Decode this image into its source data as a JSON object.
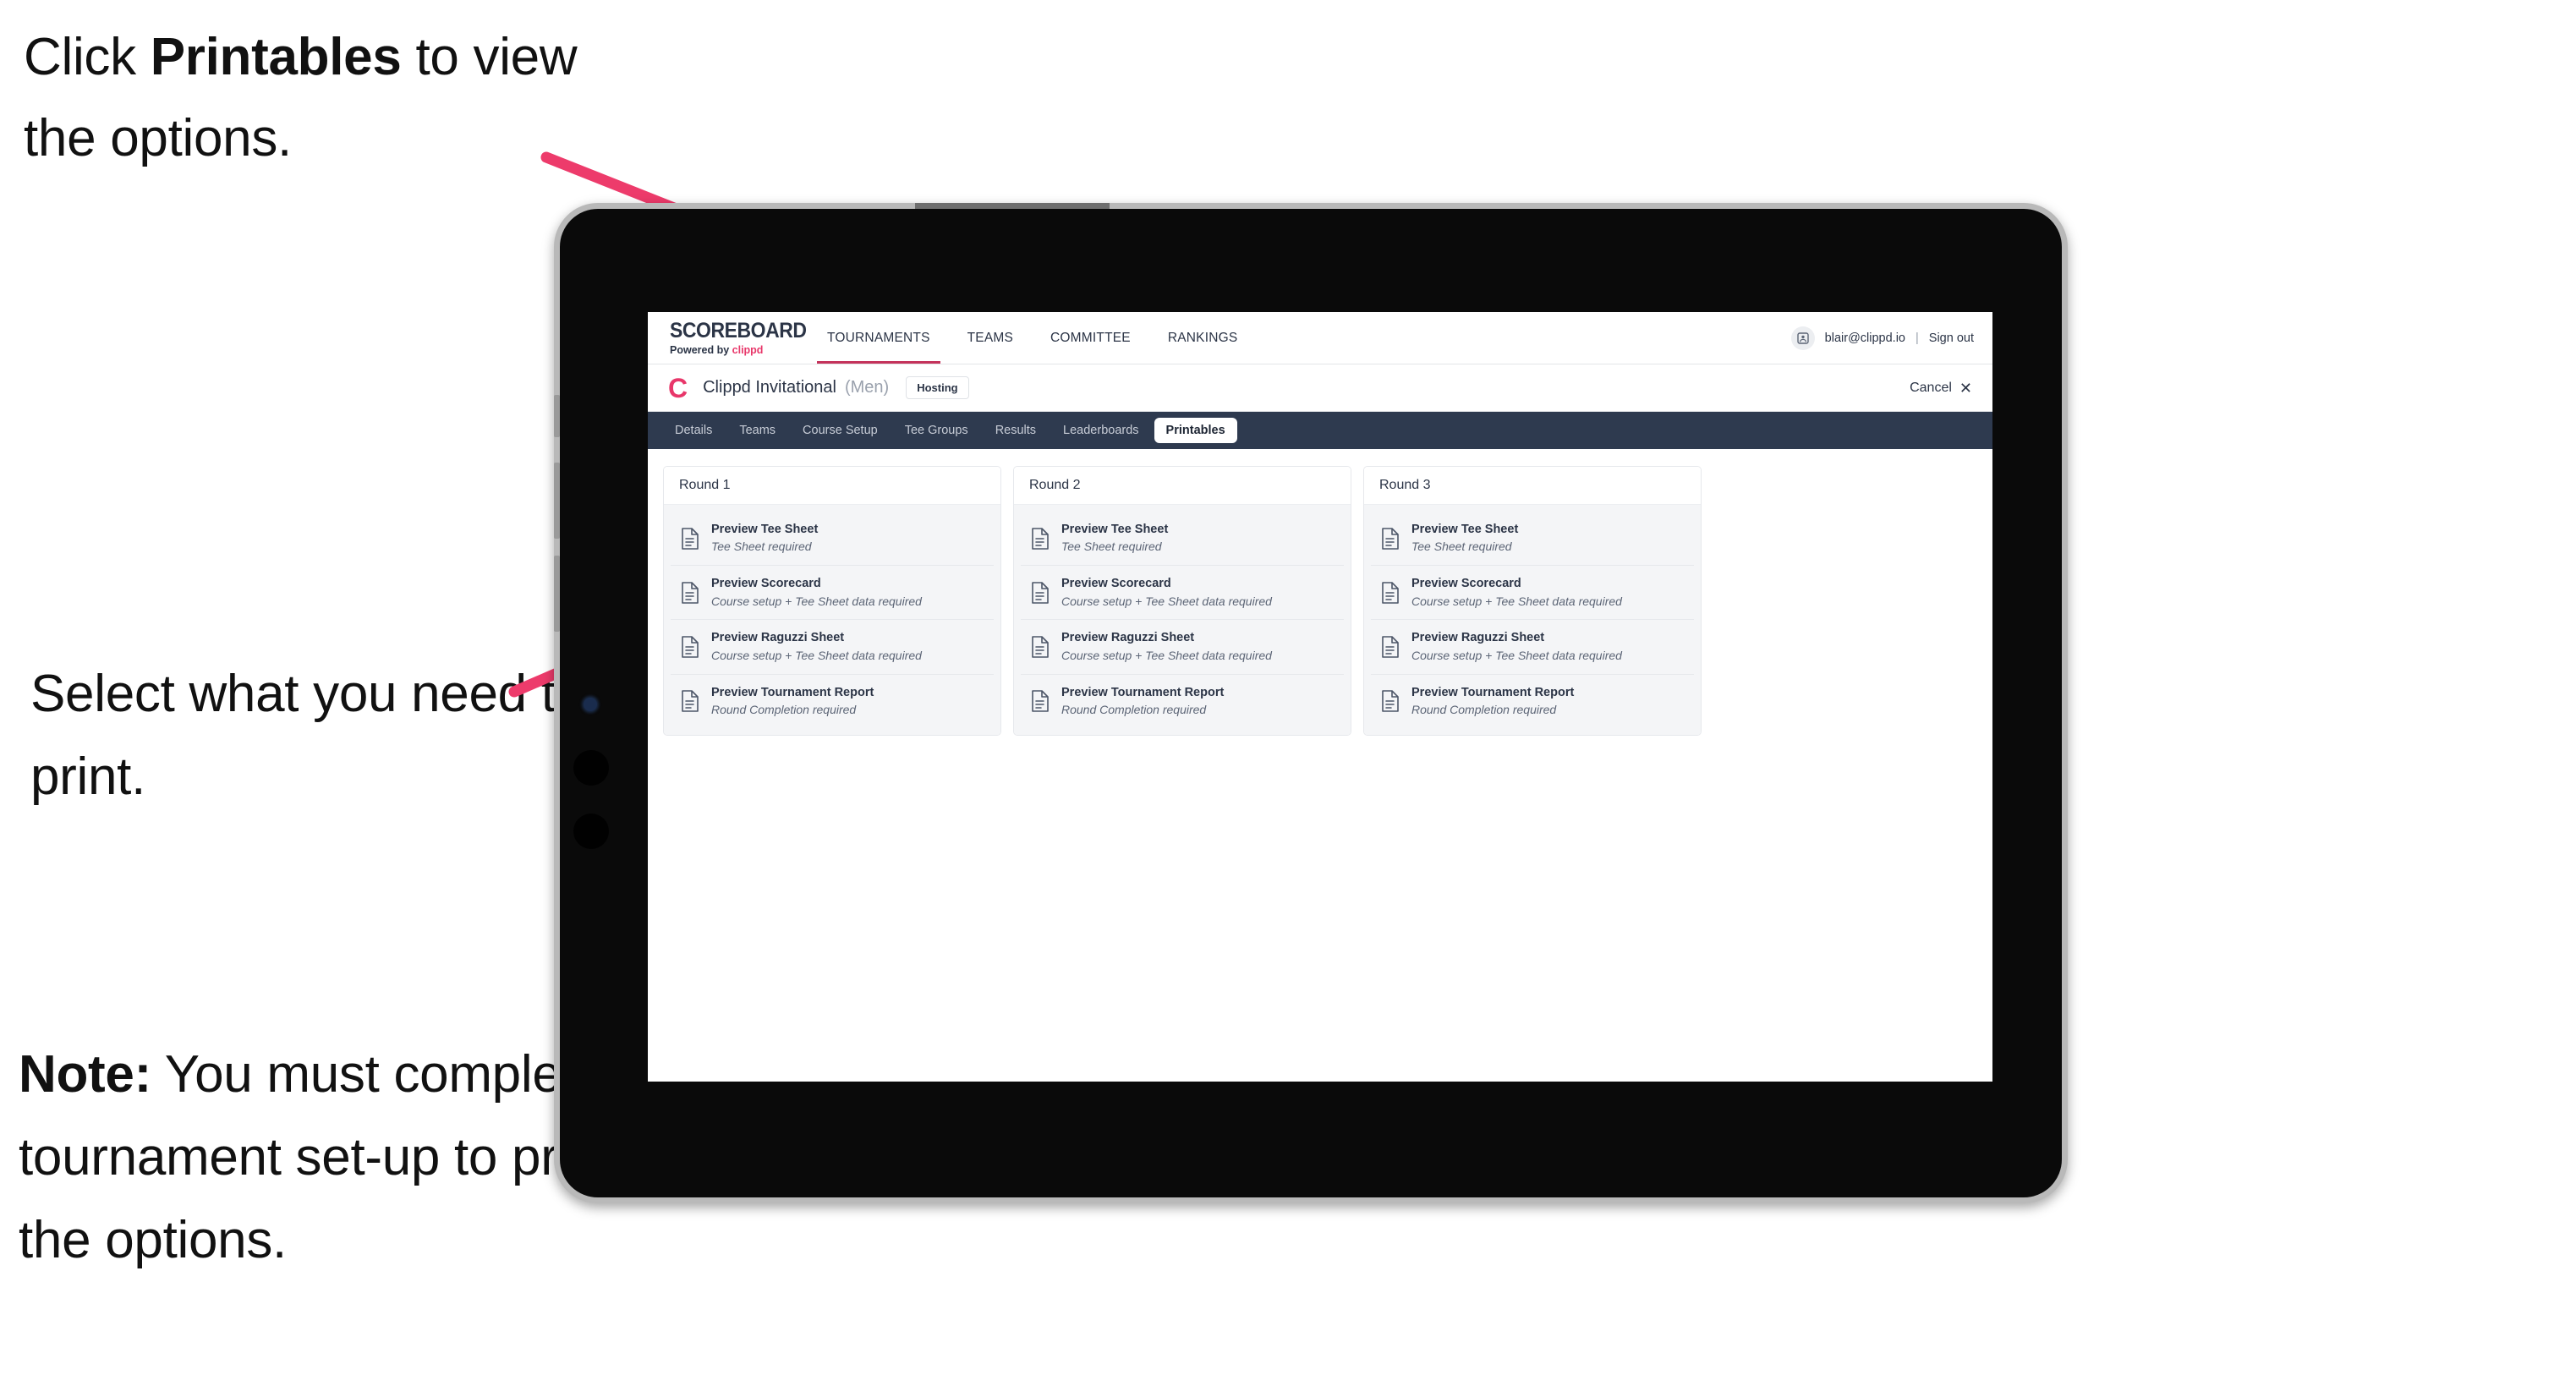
{
  "annotations": {
    "click_printables": {
      "pre": "Click ",
      "bold": "Printables",
      "post": " to view the options."
    },
    "select_print": "Select what you need to print.",
    "note": {
      "bold": "Note:",
      "rest": " You must complete the tournament set-up to print all the options."
    }
  },
  "colors": {
    "accent_pink": "#e8376a",
    "arrow_pink": "#ed3b6b",
    "tabstrip_bg": "#2e3a4f",
    "nav_active_underline": "#c4335b",
    "card_body_bg": "#f4f5f7"
  },
  "app": {
    "brand": {
      "title": "SCOREBOARD",
      "powered_prefix": "Powered by ",
      "powered_brand": "clippd"
    },
    "topnav": [
      {
        "label": "TOURNAMENTS",
        "active": true
      },
      {
        "label": "TEAMS",
        "active": false
      },
      {
        "label": "COMMITTEE",
        "active": false
      },
      {
        "label": "RANKINGS",
        "active": false
      }
    ],
    "account": {
      "avatar_glyph": "☒",
      "email": "blair@clippd.io",
      "separator": "|",
      "sign_out": "Sign out"
    },
    "tournament": {
      "logo_letter": "C",
      "name": "Clippd Invitational",
      "gender": "(Men)",
      "status_badge": "Hosting",
      "cancel_label": "Cancel",
      "cancel_icon": "✕"
    },
    "tabs": [
      {
        "label": "Details",
        "active": false
      },
      {
        "label": "Teams",
        "active": false
      },
      {
        "label": "Course Setup",
        "active": false
      },
      {
        "label": "Tee Groups",
        "active": false
      },
      {
        "label": "Results",
        "active": false
      },
      {
        "label": "Leaderboards",
        "active": false
      },
      {
        "label": "Printables",
        "active": true
      }
    ],
    "rounds": [
      {
        "header": "Round 1",
        "items": [
          {
            "title": "Preview Tee Sheet",
            "sub": "Tee Sheet required"
          },
          {
            "title": "Preview Scorecard",
            "sub": "Course setup + Tee Sheet data required"
          },
          {
            "title": "Preview Raguzzi Sheet",
            "sub": "Course setup + Tee Sheet data required"
          },
          {
            "title": "Preview Tournament Report",
            "sub": "Round Completion required"
          }
        ]
      },
      {
        "header": "Round 2",
        "items": [
          {
            "title": "Preview Tee Sheet",
            "sub": "Tee Sheet required"
          },
          {
            "title": "Preview Scorecard",
            "sub": "Course setup + Tee Sheet data required"
          },
          {
            "title": "Preview Raguzzi Sheet",
            "sub": "Course setup + Tee Sheet data required"
          },
          {
            "title": "Preview Tournament Report",
            "sub": "Round Completion required"
          }
        ]
      },
      {
        "header": "Round 3",
        "items": [
          {
            "title": "Preview Tee Sheet",
            "sub": "Tee Sheet required"
          },
          {
            "title": "Preview Scorecard",
            "sub": "Course setup + Tee Sheet data required"
          },
          {
            "title": "Preview Raguzzi Sheet",
            "sub": "Course setup + Tee Sheet data required"
          },
          {
            "title": "Preview Tournament Report",
            "sub": "Round Completion required"
          }
        ]
      }
    ]
  }
}
